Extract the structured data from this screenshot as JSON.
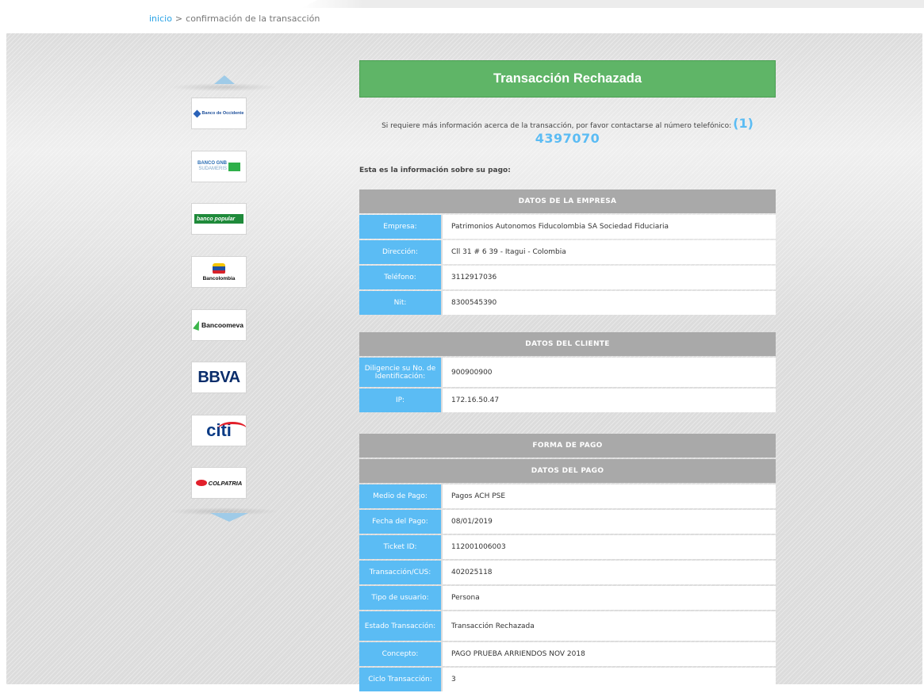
{
  "breadcrumb": {
    "home": "inicio",
    "separator": ">",
    "current": "confirmación de la transacción"
  },
  "banks": [
    {
      "name": "Banco de Occidente"
    },
    {
      "name_line1": "BANCO GNB",
      "name_line2": "SUDAMERIS"
    },
    {
      "name": "banco popular"
    },
    {
      "name": "Bancolombia"
    },
    {
      "name": "Bancoomeva"
    },
    {
      "name": "BBVA"
    },
    {
      "name": "citi"
    },
    {
      "name": "COLPATRIA"
    }
  ],
  "status": {
    "title": "Transacción Rechazada",
    "color": "#5fb567"
  },
  "info": {
    "message": "Si requiere más información acerca de la transacción, por favor contactarse al número telefónico:",
    "ref": "(1)",
    "phone": "4397070"
  },
  "intro": "Esta es la información sobre su pago:",
  "empresa": {
    "header": "DATOS DE LA EMPRESA",
    "rows": [
      {
        "label": "Empresa:",
        "value": "Patrimonios Autonomos Fiducolombia SA Sociedad Fiduciaria"
      },
      {
        "label": "Dirección:",
        "value": "Cll 31 # 6 39 - Itagui - Colombia"
      },
      {
        "label": "Teléfono:",
        "value": "3112917036"
      },
      {
        "label": "Nit:",
        "value": "8300545390"
      }
    ]
  },
  "cliente": {
    "header": "DATOS DEL CLIENTE",
    "rows": [
      {
        "label": "Diligencie su No. de Identificación:",
        "value": "900900900"
      },
      {
        "label": "IP:",
        "value": "172.16.50.47"
      }
    ]
  },
  "pago": {
    "header1": "FORMA DE PAGO",
    "header2": "DATOS DEL PAGO",
    "rows": [
      {
        "label": "Medio de Pago:",
        "value": "Pagos ACH PSE"
      },
      {
        "label": "Fecha del Pago:",
        "value": "08/01/2019"
      },
      {
        "label": "Ticket ID:",
        "value": "112001006003"
      },
      {
        "label": "Transacción/CUS:",
        "value": "402025118"
      },
      {
        "label": "Tipo de usuario:",
        "value": "Persona"
      },
      {
        "label": "Estado Transacción:",
        "value": "Transacción Rechazada"
      },
      {
        "label": "Concepto:",
        "value": "PAGO PRUEBA ARRIENDOS NOV 2018"
      },
      {
        "label": "Ciclo Transacción:",
        "value": "3"
      }
    ]
  },
  "colors": {
    "accent": "#5bbcf4",
    "header_gray": "#a9a9a9"
  }
}
